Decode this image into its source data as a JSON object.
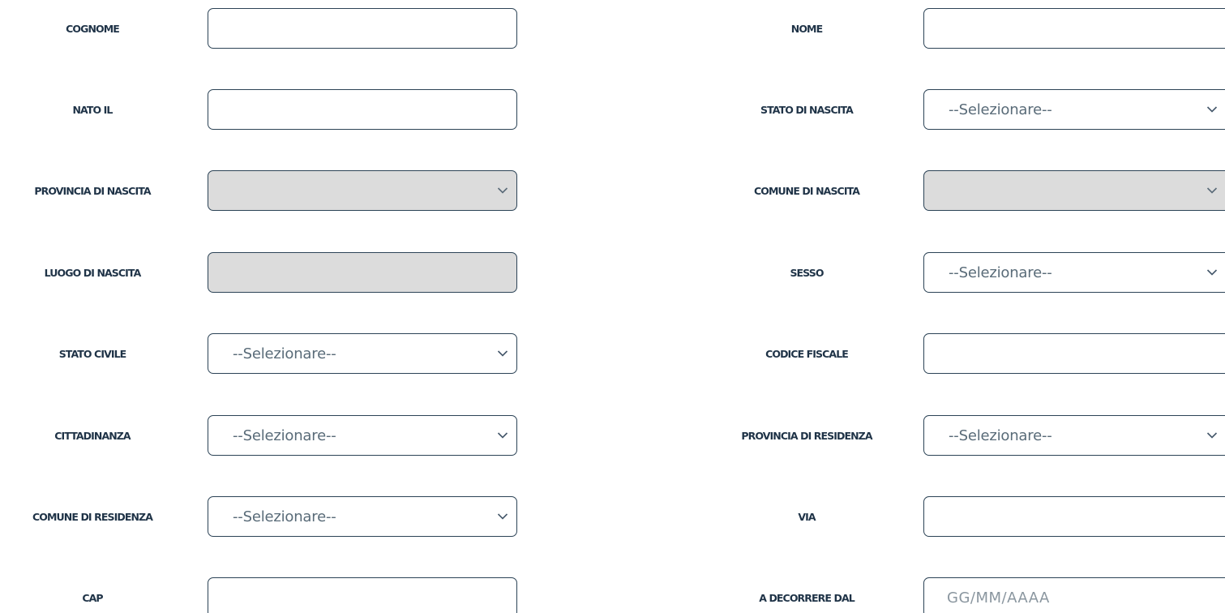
{
  "form": {
    "rows": [
      {
        "left": {
          "label": "COGNOME",
          "type": "text",
          "value": ""
        },
        "right": {
          "label": "NOME",
          "type": "text",
          "value": ""
        }
      },
      {
        "left": {
          "label": "NATO IL",
          "type": "text",
          "value": ""
        },
        "right": {
          "label": "STATO DI NASCITA",
          "type": "select",
          "value": "--Selezionare--"
        }
      },
      {
        "left": {
          "label": "PROVINCIA DI NASCITA",
          "type": "select",
          "value": "",
          "disabled": true
        },
        "right": {
          "label": "COMUNE DI NASCITA",
          "type": "select",
          "value": "",
          "disabled": true
        }
      },
      {
        "left": {
          "label": "LUOGO DI NASCITA",
          "type": "text",
          "value": "",
          "disabled": true
        },
        "right": {
          "label": "SESSO",
          "type": "select",
          "value": "--Selezionare--"
        }
      },
      {
        "left": {
          "label": "STATO CIVILE",
          "type": "select",
          "value": "--Selezionare--"
        },
        "right": {
          "label": "CODICE FISCALE",
          "type": "text",
          "value": ""
        }
      },
      {
        "left": {
          "label": "CITTADINANZA",
          "type": "select",
          "value": "--Selezionare--"
        },
        "right": {
          "label": "PROVINCIA DI RESIDENZA",
          "type": "select",
          "value": "--Selezionare--"
        }
      },
      {
        "left": {
          "label": "COMUNE DI RESIDENZA",
          "type": "select",
          "value": "--Selezionare--"
        },
        "right": {
          "label": "VIA",
          "type": "text",
          "value": ""
        }
      },
      {
        "left": {
          "label": "CAP",
          "type": "text",
          "value": ""
        },
        "right": {
          "label": "A DECORRERE DAL",
          "type": "text",
          "value": "",
          "placeholder": "GG/MM/AAAA"
        }
      }
    ]
  },
  "colors": {
    "border": "#2c4356",
    "label": "#1f3347",
    "disabled_bg": "#dcdcdc",
    "value_text": "#596b78",
    "placeholder_text": "#8a969f"
  },
  "icons": {
    "select_chevron": "chevron-down-icon"
  }
}
